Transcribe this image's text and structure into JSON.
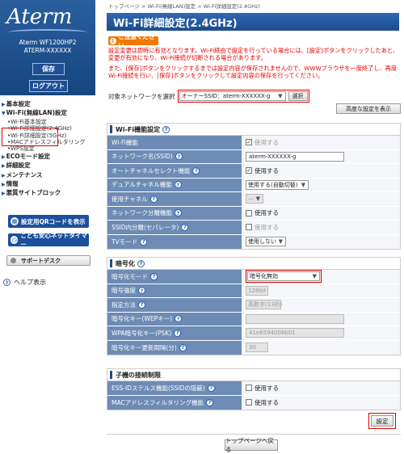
{
  "sidebar": {
    "logo": "Aterm",
    "device_line1": "Aterm  WF1200HP2",
    "device_line2": "ATERM-XXXXXX",
    "save_label": "保存",
    "logout_label": "ログアウト",
    "nav": [
      {
        "label": "基本設定",
        "type": "top"
      },
      {
        "label": "Wi-Fi(無線LAN)設定",
        "type": "top"
      },
      {
        "label": "Wi-Fi基本設定",
        "type": "sub"
      },
      {
        "label": "Wi-Fi詳細設定(2.4GHz)",
        "type": "sub"
      },
      {
        "label": "Wi-Fi詳細設定(5GHz)",
        "type": "sub"
      },
      {
        "label": "MACアドレスフィルタリング",
        "type": "sub"
      },
      {
        "label": "WPS設定",
        "type": "sub"
      },
      {
        "label": "ECOモード設定",
        "type": "top"
      },
      {
        "label": "詳細設定",
        "type": "top"
      },
      {
        "label": "メンテナンス",
        "type": "top"
      },
      {
        "label": "情報",
        "type": "top"
      },
      {
        "label": "悪質サイトブロック",
        "type": "top"
      }
    ],
    "qr_button": "設定用QRコードを表示",
    "timer_button": "こども安心ネットタイマー",
    "support_button": "サポートデスク",
    "help_link": "ヘルプ表示"
  },
  "main": {
    "breadcrumb": "トップページ > Wi-Fi(無線LAN)設定 > Wi-Fi詳細設定(2.4GHz)",
    "title": "Wi-Fi詳細設定(2.4GHz)",
    "notice_title": "ご注意ください",
    "notice_1": "設定変更は即時に有効となります。Wi-Fi経由で設定を行っている場合には、[設定]ボタンをクリックしたあと、変更が有効になり、Wi-Fi接続が切断される場合があります。",
    "notice_2": "また、[保存]ボタンをクリックするまでは設定内容が保存されませんので、WWWブラウザを一度終了し、再度Wi-Fi接続を行い、[保存]ボタンをクリックして設定内容の保存を行ってください。",
    "target_label": "対象ネットワークを選択",
    "target_value": "オーナーSSID：aterm-XXXXXX-g",
    "select_button": "選択",
    "advanced_button": "高度な設定を表示",
    "sections": {
      "wifi": {
        "title": "Wi-Fi機能設定",
        "rows": [
          {
            "label": "Wi-Fi機能",
            "value": "使用する"
          },
          {
            "label": "ネットワーク名(SSID)",
            "value": "aterm-XXXXXX-g"
          },
          {
            "label": "オートチャネルセレクト機能",
            "value": "使用する"
          },
          {
            "label": "デュアルチャネル機能",
            "value": "使用する(自動切替)"
          },
          {
            "label": "使用チャネル",
            "value": "―"
          },
          {
            "label": "ネットワーク分離機能",
            "value": "使用する"
          },
          {
            "label": "SSID内分離(セパレータ)",
            "value": "使用する"
          },
          {
            "label": "TVモード",
            "value": "使用しない"
          }
        ]
      },
      "enc": {
        "title": "暗号化",
        "rows": [
          {
            "label": "暗号化モード",
            "value": "暗号化無効"
          },
          {
            "label": "暗号強度",
            "value": "128bit"
          },
          {
            "label": "指定方法",
            "value": "英数字(13桁)"
          },
          {
            "label": "暗号化キー(WEPキー)",
            "value": ""
          },
          {
            "label": "WPA暗号化キー(PSK)",
            "value": "41e6594008b01"
          },
          {
            "label": "暗号化キー更新間隔(分)",
            "value": "30"
          }
        ]
      },
      "child": {
        "title": "子機の接続制限",
        "rows": [
          {
            "label": "ESS-IDステルス機能(SSIDの隠蔽)",
            "value": "使用する"
          },
          {
            "label": "MACアドレスフィルタリング機能",
            "value": "使用する"
          }
        ]
      }
    },
    "set_button": "設定",
    "top_button": "トップページへ戻る",
    "help_mark": "?"
  },
  "colors": {
    "accent": "#1d4c8d",
    "alert": "#e50000",
    "label_bg": "#6d8bb5",
    "notice": "#f07b00"
  }
}
